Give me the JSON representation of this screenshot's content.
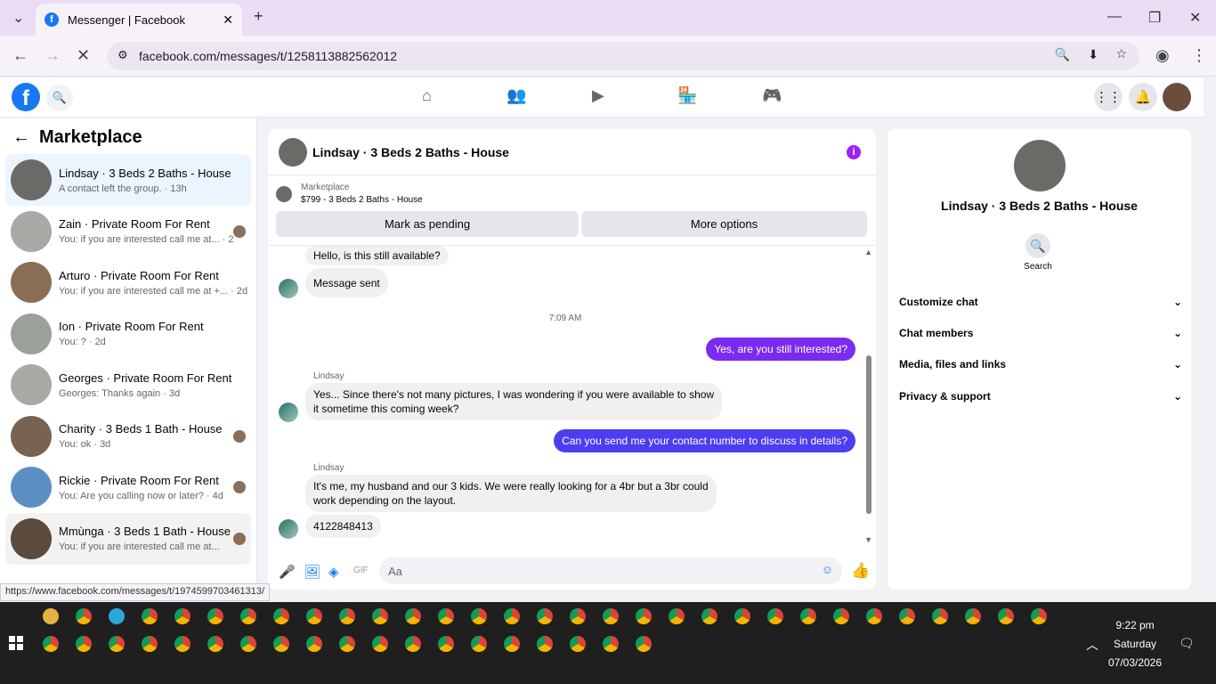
{
  "browser": {
    "tab_title": "Messenger | Facebook",
    "url": "facebook.com/messages/t/1258113882562012",
    "status_link": "https://www.facebook.com/messages/t/1974599703461313/"
  },
  "left": {
    "title": "Marketplace",
    "conversations": [
      {
        "name": "Lindsay · 3 Beds 2 Baths - House",
        "snippet": "A contact left the group. · 13h",
        "active": true,
        "color": "#6b6a67"
      },
      {
        "name": "Zain · Private Room For Rent",
        "snippet": "You: if you are interested call me at... · 2d",
        "color": "#a9a8a5"
      },
      {
        "name": "Arturo · Private Room For Rent",
        "snippet": "You: if you are interested call me at +... · 2d",
        "color": "#8a6e54"
      },
      {
        "name": "Ion · Private Room For Rent",
        "snippet": "You: ? · 2d",
        "color": "#9ba19a"
      },
      {
        "name": "Georges · Private Room For Rent",
        "snippet": "Georges: Thanks again · 3d",
        "color": "#a7aba3"
      },
      {
        "name": "Charity · 3 Beds 1 Bath - House",
        "snippet": "You: ok · 3d",
        "color": "#7a6250"
      },
      {
        "name": "Rickie · Private Room For Rent",
        "snippet": "You: Are you calling now or later? · 4d",
        "color": "#5b8fc4"
      },
      {
        "name": "Mmùnga · 3 Beds 1 Bath - House",
        "snippet": "You: if you are interested call me at...",
        "color": "#5d4a3e"
      }
    ]
  },
  "chat": {
    "title": "Lindsay · 3 Beds 2 Baths - House",
    "marketplace_label": "Marketplace",
    "listing": "$799 - 3 Beds 2 Baths - House",
    "mark_pending": "Mark as pending",
    "more_options": "More options",
    "messages": {
      "m1": "Hello, is this still available?",
      "m2": "Message sent",
      "time": "7:09 AM",
      "m3": "Yes, are you still interested?",
      "sender1": "Lindsay",
      "m4a": "Yes... Since there's not many pictures, I was wondering if you were available to show",
      "m4b": "it sometime this coming week?",
      "m5": "Can you send me your contact number to discuss in details?",
      "sender2": "Lindsay",
      "m6a": "It's me, my husband and our 3 kids. We were really looking for a 4br but a 3br could",
      "m6b": "work depending on the layout.",
      "m7": "4122848413"
    },
    "composer_placeholder": "Aa"
  },
  "right": {
    "name": "Lindsay · 3 Beds 2 Baths - House",
    "search_label": "Search",
    "sections": [
      "Customize chat",
      "Chat members",
      "Media, files and links",
      "Privacy & support"
    ]
  },
  "taskbar": {
    "time": "9:22 pm",
    "day": "Saturday",
    "date": "07/03/2026"
  }
}
